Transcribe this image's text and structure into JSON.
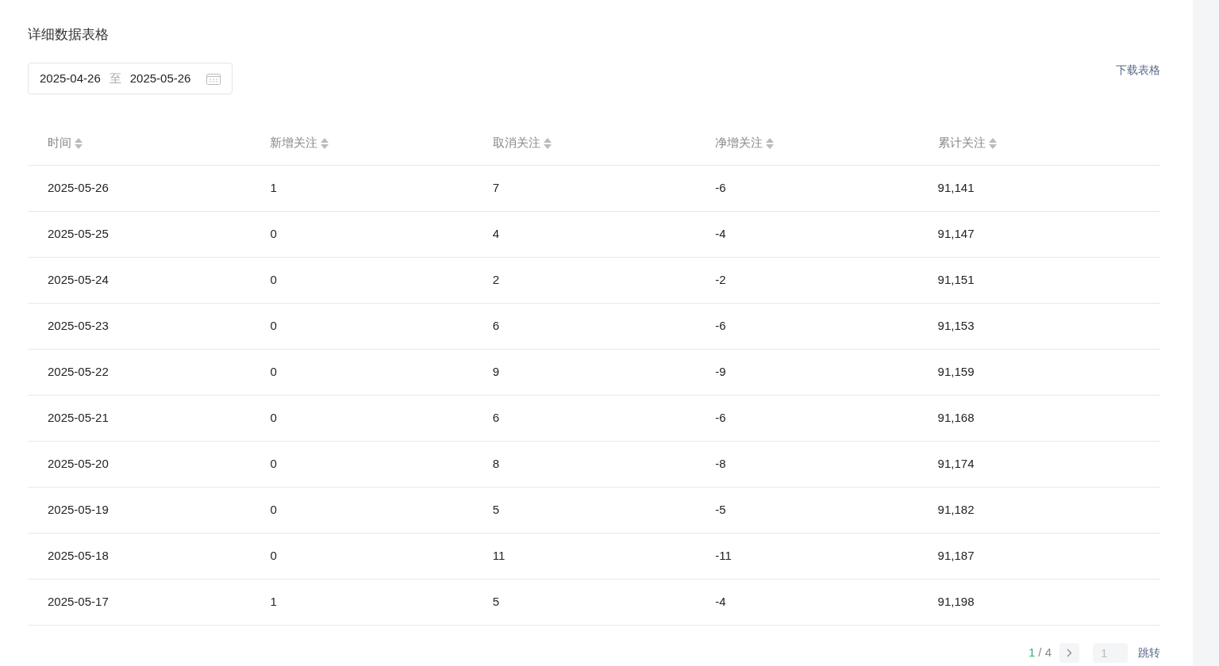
{
  "title": "详细数据表格",
  "date_range": {
    "start": "2025-04-26",
    "separator": "至",
    "end": "2025-05-26"
  },
  "download_link": "下载表格",
  "table": {
    "columns": [
      "时间",
      "新增关注",
      "取消关注",
      "净增关注",
      "累计关注"
    ],
    "rows": [
      [
        "2025-05-26",
        "1",
        "7",
        "-6",
        "91,141"
      ],
      [
        "2025-05-25",
        "0",
        "4",
        "-4",
        "91,147"
      ],
      [
        "2025-05-24",
        "0",
        "2",
        "-2",
        "91,151"
      ],
      [
        "2025-05-23",
        "0",
        "6",
        "-6",
        "91,153"
      ],
      [
        "2025-05-22",
        "0",
        "9",
        "-9",
        "91,159"
      ],
      [
        "2025-05-21",
        "0",
        "6",
        "-6",
        "91,168"
      ],
      [
        "2025-05-20",
        "0",
        "8",
        "-8",
        "91,174"
      ],
      [
        "2025-05-19",
        "0",
        "5",
        "-5",
        "91,182"
      ],
      [
        "2025-05-18",
        "0",
        "11",
        "-11",
        "91,187"
      ],
      [
        "2025-05-17",
        "1",
        "5",
        "-4",
        "91,198"
      ]
    ]
  },
  "pagination": {
    "current": "1",
    "total": "/ 4",
    "page_input": {
      "placeholder": "1"
    },
    "jump": "跳转"
  }
}
